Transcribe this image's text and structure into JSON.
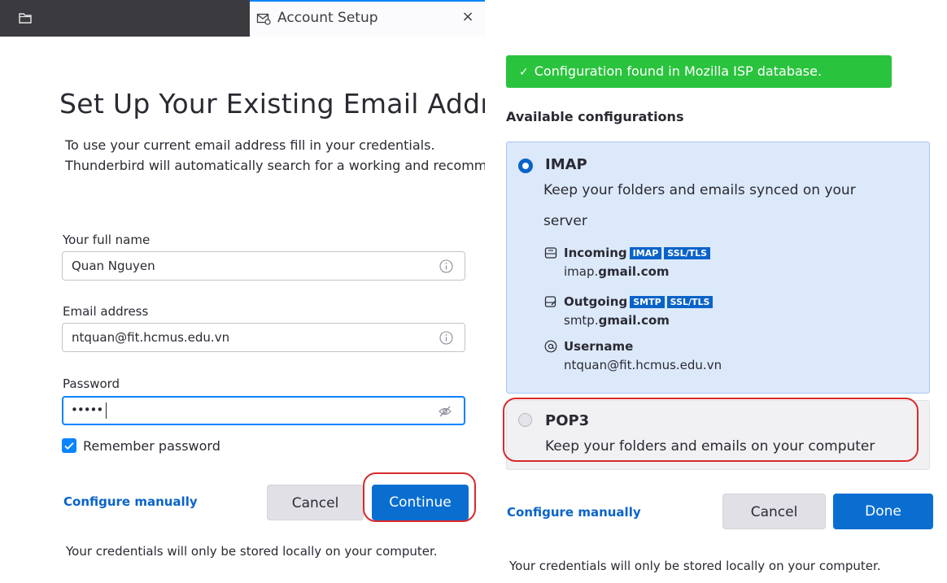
{
  "tab": {
    "title": "Account Setup",
    "close": "×"
  },
  "left": {
    "title": "Set Up Your Existing Email Address",
    "description_line1": "To use your current email address fill in your credentials.",
    "description_line2": "Thunderbird will automatically search for a working and recommended server configuration.",
    "full_name_label": "Your full name",
    "full_name_value": "Quan Nguyen",
    "email_label": "Email address",
    "email_value": "ntquan@fit.hcmus.edu.vn",
    "password_label": "Password",
    "password_mask": "•••••",
    "remember_label": "Remember password",
    "remember_checked": true,
    "configure_manually": "Configure manually",
    "cancel_label": "Cancel",
    "continue_label": "Continue",
    "footer_note": "Your credentials will only be stored locally on your computer."
  },
  "right": {
    "success_message": "Configuration found in Mozilla ISP database.",
    "available_title": "Available configurations",
    "imap": {
      "title": "IMAP",
      "desc_line1": "Keep your folders and emails synced on your",
      "desc_line2": "server",
      "incoming_label": "Incoming",
      "incoming_tags": [
        "IMAP",
        "SSL/TLS"
      ],
      "incoming_host_prefix": "imap.",
      "incoming_host_domain": "gmail.com",
      "outgoing_label": "Outgoing",
      "outgoing_tags": [
        "SMTP",
        "SSL/TLS"
      ],
      "outgoing_host_prefix": "smtp.",
      "outgoing_host_domain": "gmail.com",
      "username_label": "Username",
      "username_value": "ntquan@fit.hcmus.edu.vn"
    },
    "pop3": {
      "title": "POP3",
      "desc": "Keep your folders and emails on your computer"
    },
    "configure_manually": "Configure manually",
    "cancel_label": "Cancel",
    "done_label": "Done",
    "footer_note": "Your credentials will only be stored locally on your computer."
  },
  "colors": {
    "accent": "#0a6ed1",
    "success": "#2ac33d",
    "callout": "#d92a2a"
  }
}
